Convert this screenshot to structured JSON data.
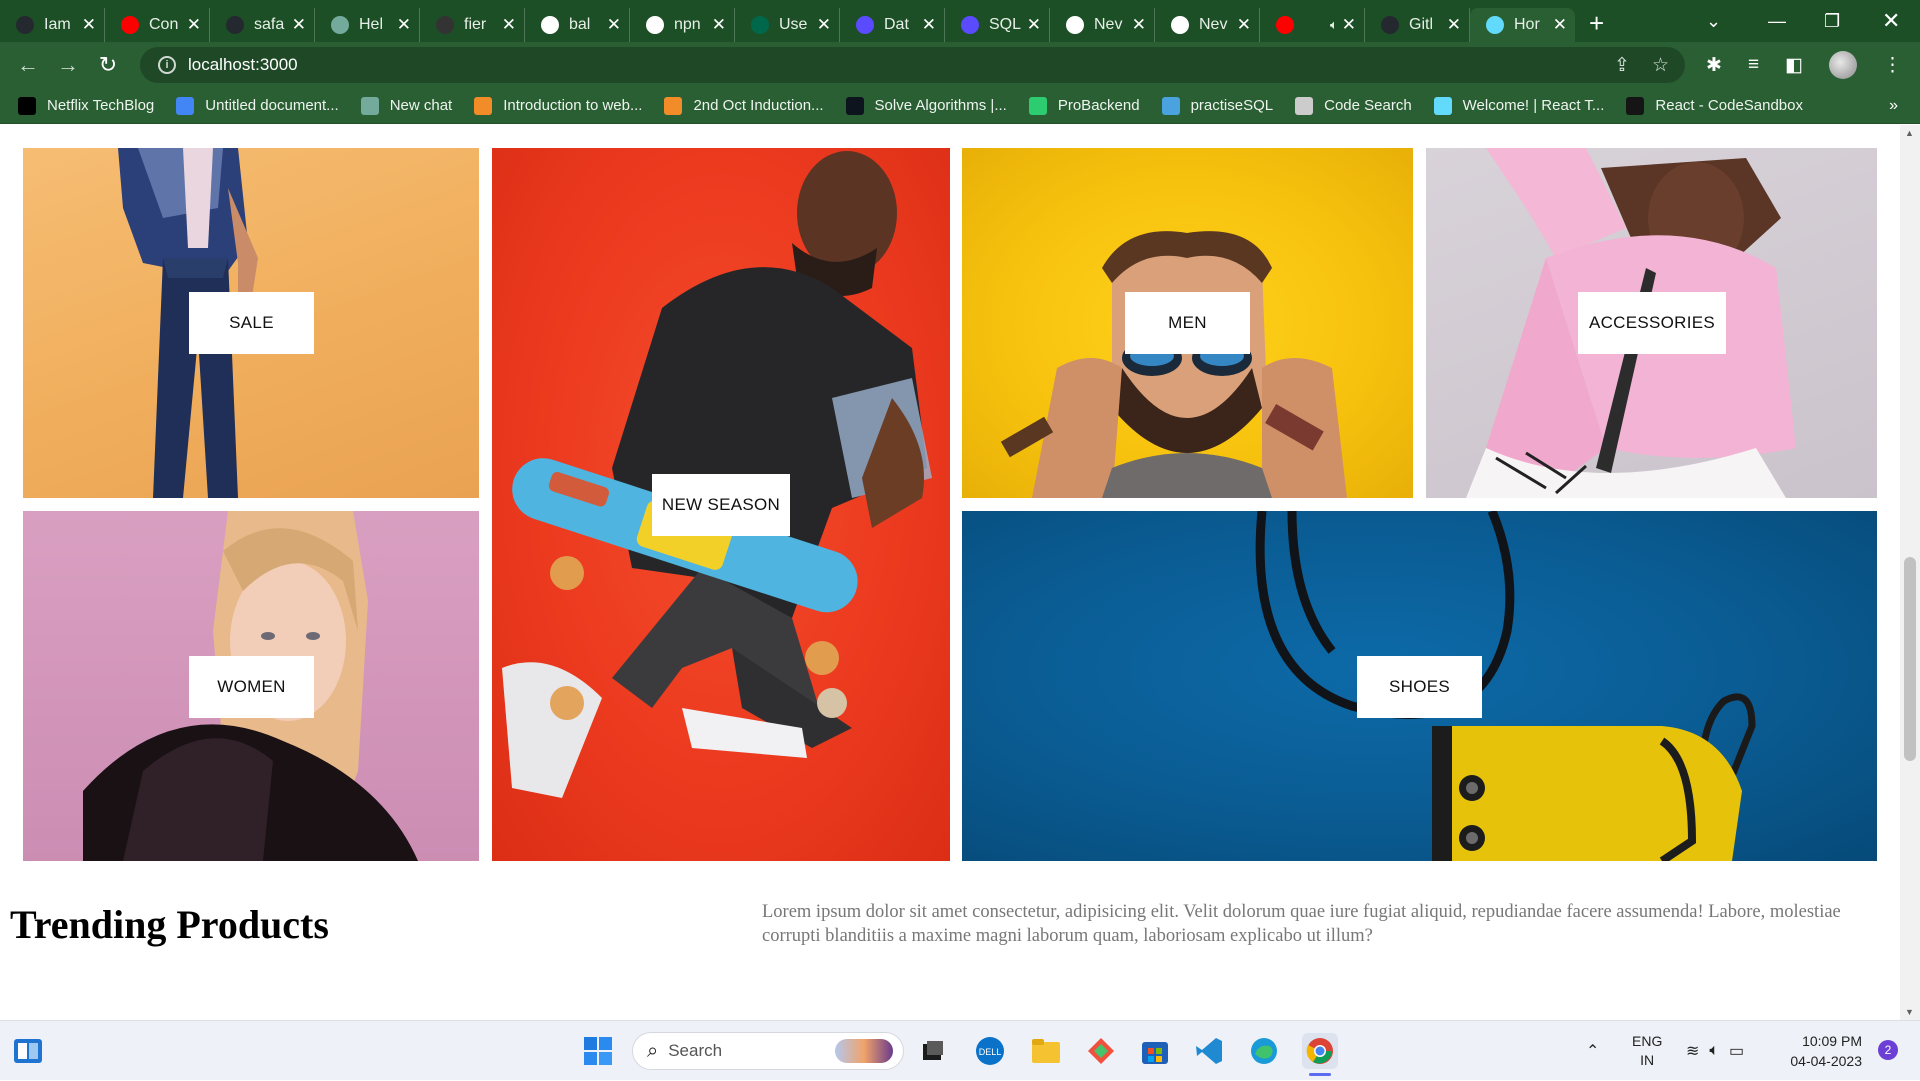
{
  "browser": {
    "tabs": [
      {
        "title": "Iam",
        "favicon": "github-icon",
        "color": "#24292f"
      },
      {
        "title": "Con",
        "favicon": "youtube-icon",
        "color": "#ff0000"
      },
      {
        "title": "safa",
        "favicon": "github-icon",
        "color": "#24292f"
      },
      {
        "title": "Hel",
        "favicon": "chatgpt-icon",
        "color": "#74aa9c"
      },
      {
        "title": "fier",
        "favicon": "gitlens-icon",
        "color": "#333333"
      },
      {
        "title": "bal",
        "favicon": "google-icon",
        "color": "#ffffff"
      },
      {
        "title": "npn",
        "favicon": "google-icon",
        "color": "#ffffff"
      },
      {
        "title": "Use",
        "favicon": "mongodb-icon",
        "color": "#00684a"
      },
      {
        "title": "Dat",
        "favicon": "sql-icon",
        "color": "#5b4bff"
      },
      {
        "title": "SQL",
        "favicon": "sql-icon",
        "color": "#5b4bff"
      },
      {
        "title": "Nev",
        "favicon": "chrome-icon",
        "color": "#ffffff"
      },
      {
        "title": "Nev",
        "favicon": "chrome-icon",
        "color": "#ffffff"
      },
      {
        "title": "",
        "favicon": "youtube-icon",
        "color": "#ff0000",
        "audio": true
      },
      {
        "title": "Gitl",
        "favicon": "github-icon",
        "color": "#24292f"
      },
      {
        "title": "Hor",
        "favicon": "react-icon",
        "color": "#61dafb",
        "active": true
      }
    ],
    "address": "localhost:3000",
    "bookmarks": [
      {
        "label": "Netflix TechBlog",
        "icon": "medium-icon",
        "color": "#000000"
      },
      {
        "label": "Untitled document...",
        "icon": "docs-icon",
        "color": "#4285f4"
      },
      {
        "label": "New chat",
        "icon": "chatgpt-icon",
        "color": "#74aa9c"
      },
      {
        "label": "Introduction to web...",
        "icon": "course-icon",
        "color": "#f28c28"
      },
      {
        "label": "2nd Oct Induction...",
        "icon": "course-icon",
        "color": "#f28c28"
      },
      {
        "label": "Solve Algorithms |...",
        "icon": "hackerrank-icon",
        "color": "#0e141e"
      },
      {
        "label": "ProBackend",
        "icon": "code-icon",
        "color": "#2ecc71"
      },
      {
        "label": "practiseSQL",
        "icon": "wave-icon",
        "color": "#4aa3df"
      },
      {
        "label": "Code Search",
        "icon": "dots-icon",
        "color": "#cccccc"
      },
      {
        "label": "Welcome! | React T...",
        "icon": "react-icon",
        "color": "#61dafb"
      },
      {
        "label": "React - CodeSandbox",
        "icon": "codesandbox-icon",
        "color": "#151515"
      }
    ]
  },
  "categories": [
    {
      "label": "SALE"
    },
    {
      "label": "WOMEN"
    },
    {
      "label": "NEW SEASON"
    },
    {
      "label": "MEN"
    },
    {
      "label": "ACCESSORIES"
    },
    {
      "label": "SHOES"
    }
  ],
  "trending": {
    "title": "Trending Products",
    "description": "Lorem ipsum dolor sit amet consectetur, adipisicing elit. Velit dolorum quae iure fugiat aliquid, repudiandae facere assumenda! Labore, molestiae corrupti blanditiis a maxime magni laborum quam, laboriosam explicabo ut illum?"
  },
  "taskbar": {
    "search_placeholder": "Search",
    "language": "ENG",
    "region": "IN",
    "time": "10:09 PM",
    "date": "04-04-2023",
    "notifications": "2"
  }
}
